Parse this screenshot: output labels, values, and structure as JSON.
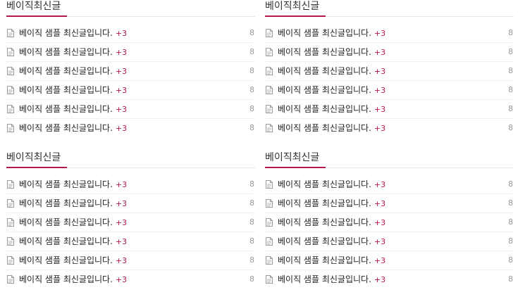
{
  "accent_color": "#b8164f",
  "icons": {
    "post": "document-icon"
  },
  "widgets": [
    {
      "title": "베이직최신글",
      "items": [
        {
          "title": "베이직 샘플 최신글입니다.",
          "comments": "+3",
          "count": "8"
        },
        {
          "title": "베이직 샘플 최신글입니다.",
          "comments": "+3",
          "count": "8"
        },
        {
          "title": "베이직 샘플 최신글입니다.",
          "comments": "+3",
          "count": "8"
        },
        {
          "title": "베이직 샘플 최신글입니다.",
          "comments": "+3",
          "count": "8"
        },
        {
          "title": "베이직 샘플 최신글입니다.",
          "comments": "+3",
          "count": "8"
        },
        {
          "title": "베이직 샘플 최신글입니다.",
          "comments": "+3",
          "count": "8"
        }
      ]
    },
    {
      "title": "베이직최신글",
      "items": [
        {
          "title": "베이직 샘플 최신글입니다.",
          "comments": "+3",
          "count": "8"
        },
        {
          "title": "베이직 샘플 최신글입니다.",
          "comments": "+3",
          "count": "8"
        },
        {
          "title": "베이직 샘플 최신글입니다.",
          "comments": "+3",
          "count": "8"
        },
        {
          "title": "베이직 샘플 최신글입니다.",
          "comments": "+3",
          "count": "8"
        },
        {
          "title": "베이직 샘플 최신글입니다.",
          "comments": "+3",
          "count": "8"
        },
        {
          "title": "베이직 샘플 최신글입니다.",
          "comments": "+3",
          "count": "8"
        }
      ]
    },
    {
      "title": "베이직최신글",
      "items": [
        {
          "title": "베이직 샘플 최신글입니다.",
          "comments": "+3",
          "count": "8"
        },
        {
          "title": "베이직 샘플 최신글입니다.",
          "comments": "+3",
          "count": "8"
        },
        {
          "title": "베이직 샘플 최신글입니다.",
          "comments": "+3",
          "count": "8"
        },
        {
          "title": "베이직 샘플 최신글입니다.",
          "comments": "+3",
          "count": "8"
        },
        {
          "title": "베이직 샘플 최신글입니다.",
          "comments": "+3",
          "count": "8"
        },
        {
          "title": "베이직 샘플 최신글입니다.",
          "comments": "+3",
          "count": "8"
        }
      ]
    },
    {
      "title": "베이직최신글",
      "items": [
        {
          "title": "베이직 샘플 최신글입니다.",
          "comments": "+3",
          "count": "8"
        },
        {
          "title": "베이직 샘플 최신글입니다.",
          "comments": "+3",
          "count": "8"
        },
        {
          "title": "베이직 샘플 최신글입니다.",
          "comments": "+3",
          "count": "8"
        },
        {
          "title": "베이직 샘플 최신글입니다.",
          "comments": "+3",
          "count": "8"
        },
        {
          "title": "베이직 샘플 최신글입니다.",
          "comments": "+3",
          "count": "8"
        },
        {
          "title": "베이직 샘플 최신글입니다.",
          "comments": "+3",
          "count": "8"
        }
      ]
    }
  ]
}
